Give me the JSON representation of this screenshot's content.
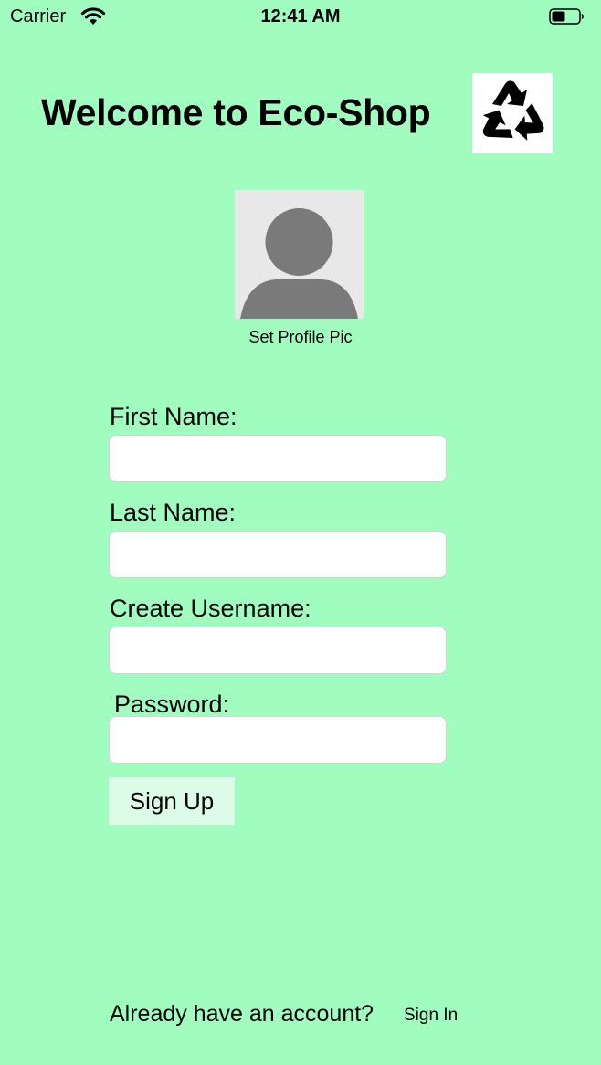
{
  "status_bar": {
    "carrier": "Carrier",
    "time": "12:41 AM",
    "wifi_icon": "wifi-icon",
    "battery_icon": "battery-icon"
  },
  "header": {
    "title": "Welcome to Eco-Shop",
    "logo_icon": "recycle-icon"
  },
  "profile": {
    "avatar_icon": "person-silhouette-icon",
    "label": "Set Profile Pic"
  },
  "form": {
    "first_name_label": "First Name:",
    "first_name_value": "",
    "last_name_label": "Last Name:",
    "last_name_value": "",
    "username_label": "Create Username:",
    "username_value": "",
    "password_label": "Password:",
    "password_value": "",
    "signup_label": "Sign Up"
  },
  "footer": {
    "prompt": "Already have an account?",
    "signin_label": "Sign In"
  },
  "colors": {
    "background": "#a1fdbf",
    "button_bg": "#dcfce7",
    "field_bg": "#ffffff",
    "avatar_bg": "#e8e8e8",
    "avatar_fg": "#7a7a7a"
  }
}
